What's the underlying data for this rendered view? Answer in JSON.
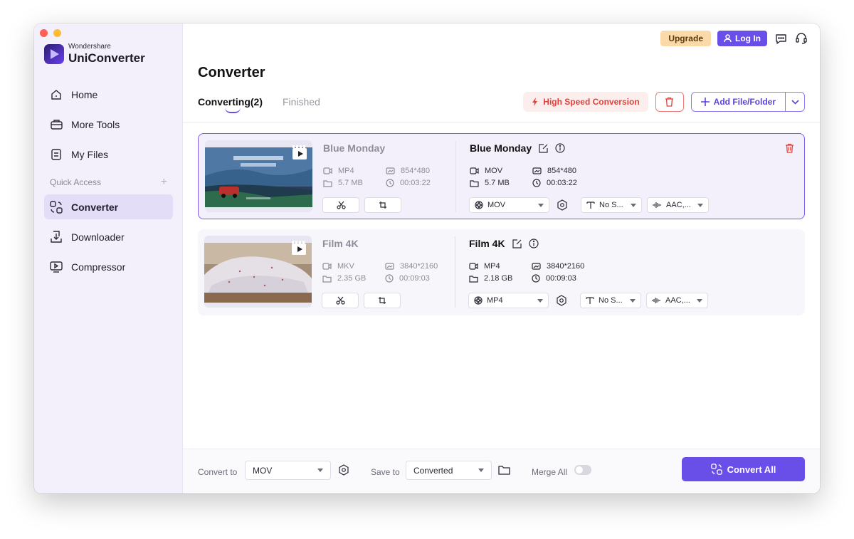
{
  "brand": {
    "small": "Wondershare",
    "big": "UniConverter"
  },
  "sidebar": {
    "items": [
      {
        "label": "Home",
        "icon": "home-icon"
      },
      {
        "label": "More Tools",
        "icon": "toolbox-icon"
      },
      {
        "label": "My Files",
        "icon": "files-icon"
      }
    ],
    "quick_access": "Quick Access",
    "quick_items": [
      {
        "label": "Converter",
        "icon": "converter-icon",
        "active": true
      },
      {
        "label": "Downloader",
        "icon": "downloader-icon"
      },
      {
        "label": "Compressor",
        "icon": "compressor-icon"
      }
    ]
  },
  "topbar": {
    "upgrade": "Upgrade",
    "login": "Log In"
  },
  "page": {
    "title": "Converter"
  },
  "tabs": {
    "converting": "Converting(2)",
    "finished": "Finished"
  },
  "actions": {
    "high_speed": "High Speed Conversion",
    "add_file": "Add File/Folder"
  },
  "files": [
    {
      "src_name": "Blue Monday",
      "src_format": "MP4",
      "src_size": "5.7 MB",
      "src_res": "854*480",
      "src_duration": "00:03:22",
      "dst_name": "Blue Monday",
      "dst_format": "MOV",
      "dst_size": "5.7 MB",
      "dst_res": "854*480",
      "dst_duration": "00:03:22",
      "output_format": "MOV",
      "subtitle": "No S...",
      "audio": "AAC,..."
    },
    {
      "src_name": "Film 4K",
      "src_format": "MKV",
      "src_size": "2.35 GB",
      "src_res": "3840*2160",
      "src_duration": "00:09:03",
      "dst_name": "Film 4K",
      "dst_format": "MP4",
      "dst_size": "2.18 GB",
      "dst_res": "3840*2160",
      "dst_duration": "00:09:03",
      "output_format": "MP4",
      "subtitle": "No S...",
      "audio": "AAC,..."
    }
  ],
  "bottom": {
    "convert_to_label": "Convert to",
    "convert_to_value": "MOV",
    "save_to_label": "Save to",
    "save_to_value": "Converted",
    "merge_label": "Merge All",
    "merge_on": false,
    "convert_all": "Convert All"
  },
  "colors": {
    "accent": "#6a4ee8",
    "danger": "#e0423a",
    "upgrade": "#fcd9a8"
  }
}
